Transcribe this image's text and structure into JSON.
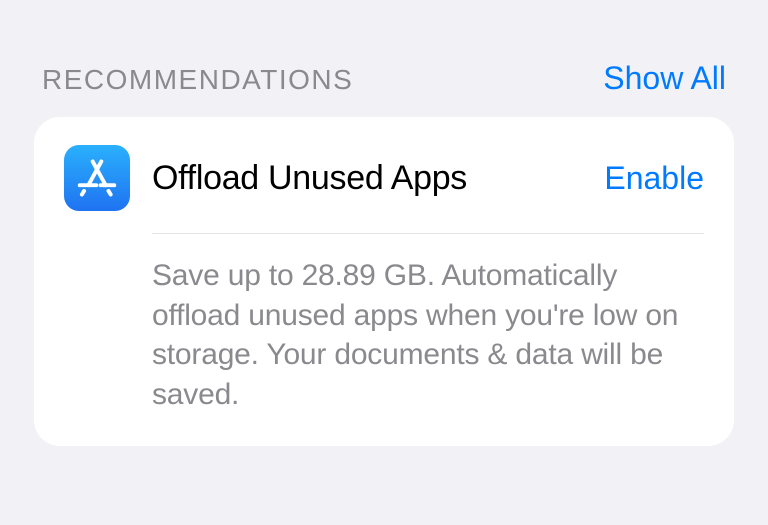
{
  "section": {
    "title": "RECOMMENDATIONS",
    "show_all_label": "Show All"
  },
  "recommendation": {
    "icon": "app-store-icon",
    "title": "Offload Unused Apps",
    "action_label": "Enable",
    "description": "Save up to 28.89 GB. Automatically offload unused apps when you're low on storage. Your documents & data will be saved."
  },
  "colors": {
    "link": "#007aff",
    "secondary_text": "#8a8a8e",
    "background": "#f2f2f6"
  }
}
